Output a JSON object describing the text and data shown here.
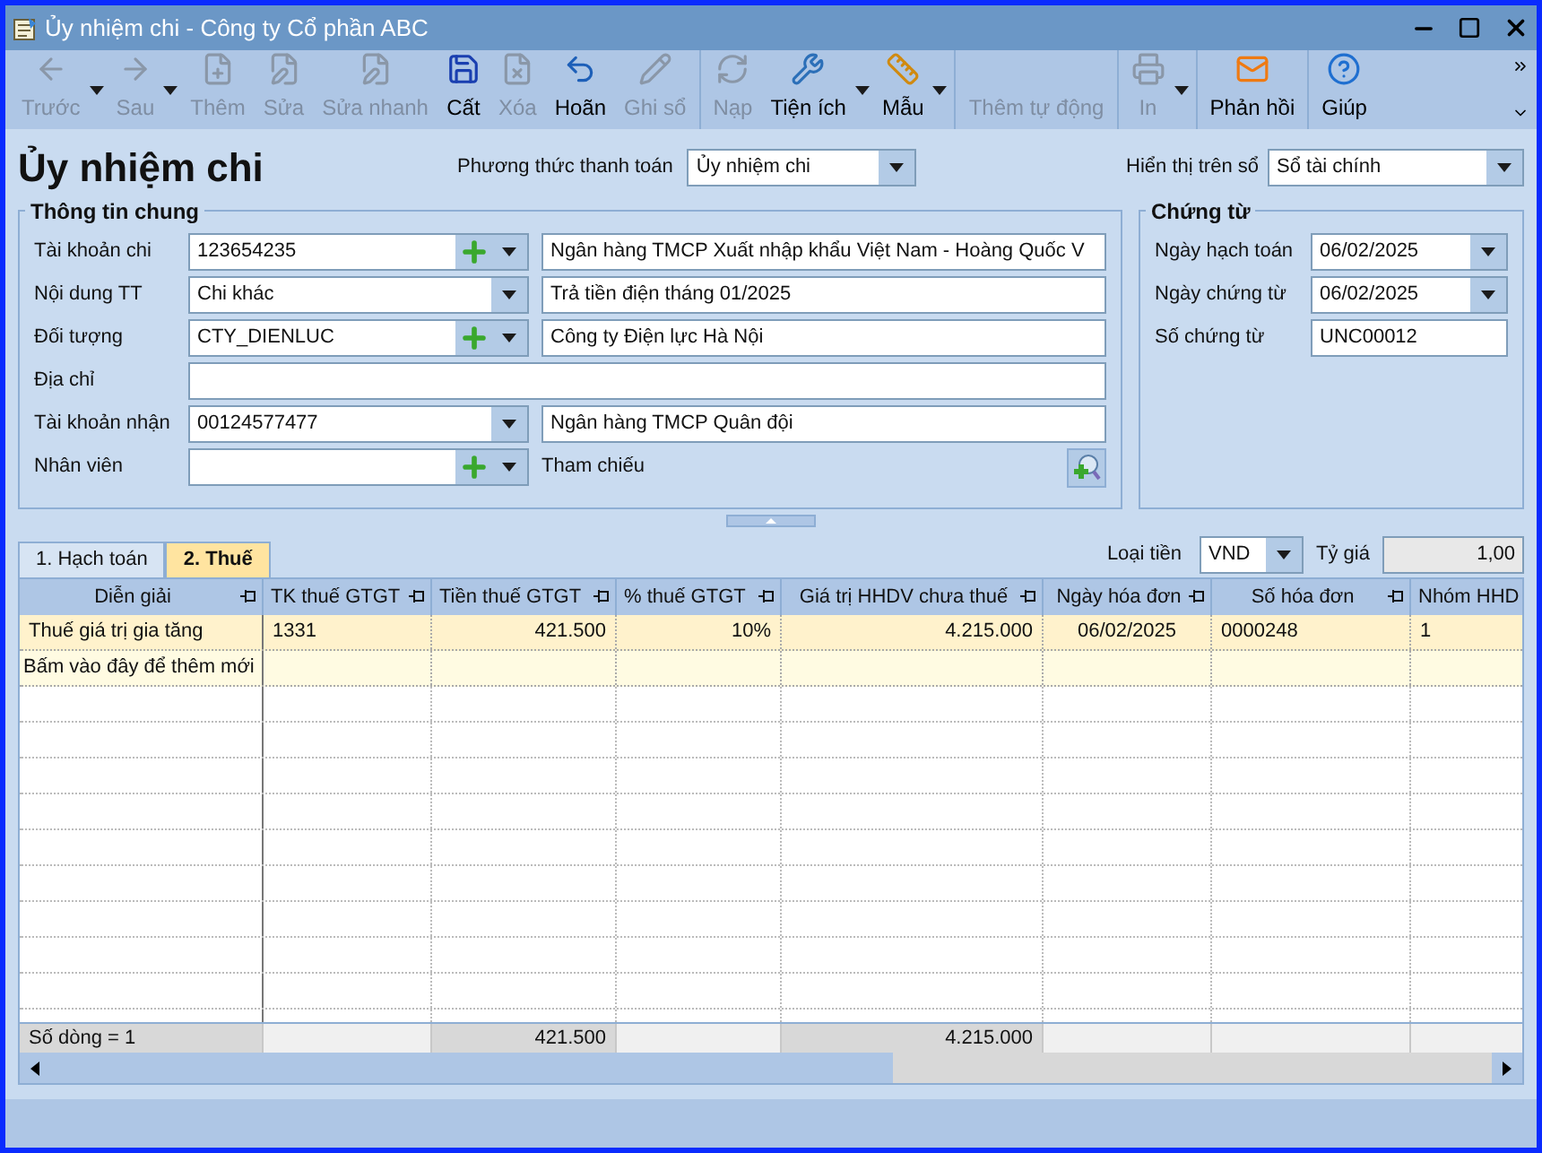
{
  "window": {
    "title": "Ủy nhiệm chi - Công ty Cổ phần ABC"
  },
  "toolbar": {
    "groups": [
      [
        {
          "label": "Trước",
          "disabled": true,
          "has_menu": true
        },
        {
          "label": "Sau",
          "disabled": true,
          "has_menu": true
        },
        {
          "label": "Thêm",
          "disabled": true,
          "has_menu": false
        },
        {
          "label": "Sửa",
          "disabled": true,
          "has_menu": false
        },
        {
          "label": "Sửa nhanh",
          "disabled": true,
          "has_menu": false
        },
        {
          "label": "Cất",
          "disabled": false,
          "has_menu": false
        },
        {
          "label": "Xóa",
          "disabled": true,
          "has_menu": false
        },
        {
          "label": "Hoãn",
          "disabled": false,
          "has_menu": false
        },
        {
          "label": "Ghi sổ",
          "disabled": true,
          "has_menu": false
        }
      ],
      [
        {
          "label": "Nạp",
          "disabled": true,
          "has_menu": false
        },
        {
          "label": "Tiện ích",
          "disabled": false,
          "has_menu": true
        },
        {
          "label": "Mẫu",
          "disabled": false,
          "has_menu": true
        }
      ],
      [
        {
          "label": "Thêm tự động",
          "disabled": true,
          "has_menu": false
        }
      ],
      [
        {
          "label": "In",
          "disabled": true,
          "has_menu": true
        }
      ],
      [
        {
          "label": "Phản hồi",
          "disabled": false,
          "has_menu": false
        }
      ],
      [
        {
          "label": "Giúp",
          "disabled": false,
          "has_menu": false
        }
      ]
    ]
  },
  "form_title": "Ủy nhiệm chi",
  "payment_method": {
    "label": "Phương thức thanh toán",
    "value": "Ủy nhiệm chi"
  },
  "display_on_book": {
    "label": "Hiển thị trên sổ",
    "value": "Sổ tài chính"
  },
  "general_info": {
    "title": "Thông tin chung",
    "rows": [
      {
        "kind": "combo",
        "label": "Tài khoản chi",
        "value": "123654235",
        "add_button": true,
        "detail": "Ngân hàng TMCP Xuất nhập khẩu Việt Nam - Hoàng Quốc V"
      },
      {
        "kind": "combo",
        "label": "Nội dung TT",
        "value": "Chi khác",
        "add_button": false,
        "detail": "Trả tiền điện tháng 01/2025"
      },
      {
        "kind": "combo",
        "label": "Đối tượng",
        "value": "CTY_DIENLUC",
        "add_button": true,
        "detail": "Công ty Điện lực Hà Nội"
      },
      {
        "kind": "wide",
        "label": "Địa chỉ"
      },
      {
        "kind": "combo",
        "label": "Tài khoản nhận",
        "value": "00124577477",
        "add_button": false,
        "detail": "Ngân hàng TMCP Quân đội"
      },
      {
        "kind": "reference",
        "label": "Nhân viên",
        "add_button": true,
        "reference_label": "Tham chiếu"
      }
    ]
  },
  "voucher": {
    "title": "Chứng từ",
    "fields": [
      {
        "kind": "date",
        "label": "Ngày hạch toán",
        "value": "06/02/2025"
      },
      {
        "kind": "date",
        "label": "Ngày chứng từ",
        "value": "06/02/2025"
      },
      {
        "kind": "text",
        "label": "Số chứng từ",
        "value": "UNC00012"
      }
    ]
  },
  "tabs": [
    {
      "label": "1. Hạch toán",
      "selected": false
    },
    {
      "label": "2. Thuế",
      "selected": true
    }
  ],
  "currency": {
    "label": "Loại tiền",
    "value": "VND"
  },
  "exchange_rate": {
    "label": "Tỷ giá",
    "value": "1,00"
  },
  "table": {
    "columns": [
      "Diễn giải",
      "TK thuế GTGT",
      "Tiền thuế GTGT",
      "% thuế GTGT",
      "Giá trị HHDV chưa thuế",
      "Ngày hóa đơn",
      "Số hóa đơn",
      "Nhóm HHD"
    ],
    "rows": [
      {
        "selected": true,
        "cells": [
          "Thuế giá trị gia tăng",
          "1331",
          "421.500",
          "10%",
          "4.215.000",
          "06/02/2025",
          "0000248",
          "1"
        ]
      }
    ],
    "new_row_hint": "Bấm vào đây để thêm mới",
    "footer": {
      "row_count": "Số dòng = 1",
      "tax_total": "421.500",
      "value_total": "4.215.000"
    }
  }
}
